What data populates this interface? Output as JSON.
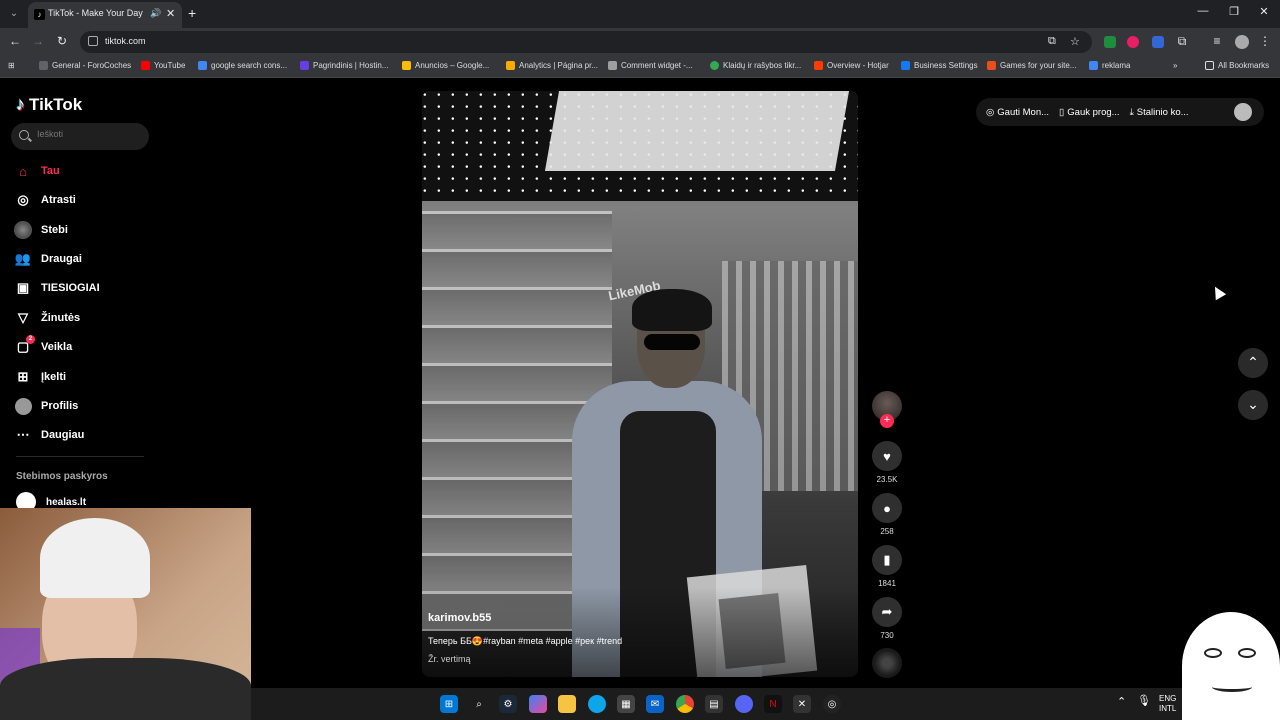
{
  "browser": {
    "tab_title": "TikTok - Make Your Day",
    "url": "tiktok.com",
    "bookmarks": [
      {
        "label": "General - ForoCoches",
        "color": "#5f6368"
      },
      {
        "label": "YouTube",
        "color": "#ff0000"
      },
      {
        "label": "google search cons...",
        "color": "#4285f4"
      },
      {
        "label": "Pagrindinis | Hostin...",
        "color": "#673de6"
      },
      {
        "label": "Anuncios – Google...",
        "color": "#fbbc04"
      },
      {
        "label": "Analytics | Página pr...",
        "color": "#f9ab00"
      },
      {
        "label": "Comment widget -...",
        "color": "#9e9e9e"
      },
      {
        "label": "Klaidų ir rašybos tikr...",
        "color": "#34a853"
      },
      {
        "label": "Overview - Hotjar",
        "color": "#ff3c00"
      },
      {
        "label": "Business Settings",
        "color": "#1877f2"
      },
      {
        "label": "Games for your site...",
        "color": "#e94e1b"
      },
      {
        "label": "reklama",
        "color": "#4285f4"
      }
    ],
    "all_bookmarks": "All Bookmarks"
  },
  "tiktok": {
    "logo": "TikTok",
    "search_placeholder": "Ieškoti",
    "nav": [
      {
        "label": "Tau",
        "icon": "home-icon",
        "active": true
      },
      {
        "label": "Atrasti",
        "icon": "compass-icon",
        "active": false
      },
      {
        "label": "Stebi",
        "icon": "following-avatar-icon",
        "active": false
      },
      {
        "label": "Draugai",
        "icon": "friends-icon",
        "active": false
      },
      {
        "label": "TIESIOGIAI",
        "icon": "live-icon",
        "active": false
      },
      {
        "label": "Žinutės",
        "icon": "messages-icon",
        "active": false
      },
      {
        "label": "Veikla",
        "icon": "activity-icon",
        "active": false,
        "badge": "2"
      },
      {
        "label": "Įkelti",
        "icon": "upload-icon",
        "active": false
      },
      {
        "label": "Profilis",
        "icon": "profile-icon",
        "active": false
      },
      {
        "label": "Daugiau",
        "icon": "more-icon",
        "active": false
      }
    ],
    "following_title": "Stebimos paskyros",
    "following_account": "healas.lt",
    "header": {
      "coins": "Gauti Mon...",
      "app": "Gauk prog...",
      "desktop": "Stalinio ko..."
    },
    "video": {
      "store_sign": "LikeMob",
      "author": "karimov.b55",
      "caption": "Теперь ББ😍#rayban #meta #apple #рек #trend",
      "translate": "Žr. vertimą"
    },
    "actions": {
      "likes": "23.5K",
      "comments": "258",
      "saves": "1841",
      "shares": "730"
    }
  },
  "taskbar": {
    "lang_top": "ENG",
    "lang_bottom": "INTL"
  },
  "colors": {
    "tiktok_red": "#fe2c55",
    "tiktok_cyan": "#25f4ee",
    "chrome_dark": "#202124",
    "chrome_mid": "#35363a"
  }
}
